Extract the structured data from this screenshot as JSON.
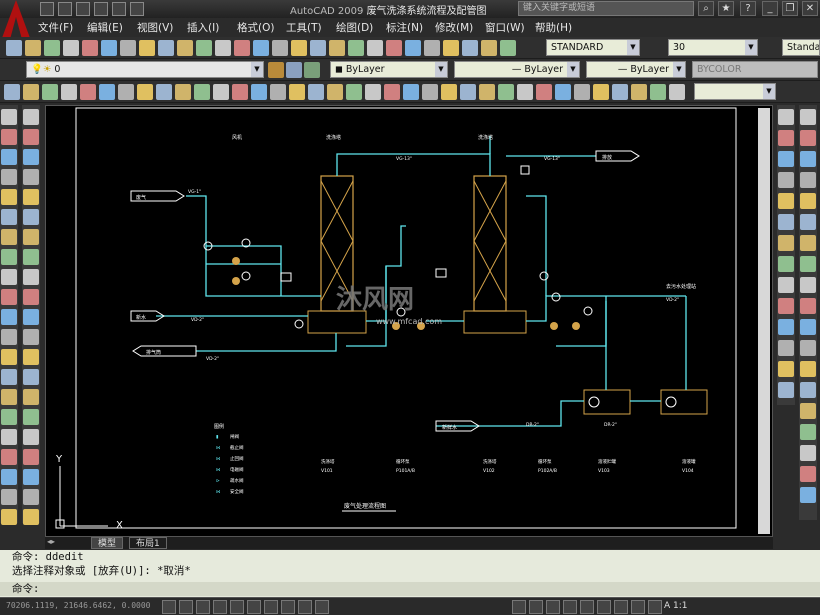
{
  "title": {
    "app": "AutoCAD 2009",
    "document": "废气洗涤系统流程及配管图"
  },
  "search": {
    "placeholder": "键入关键字或短语"
  },
  "menu": [
    "文件(F)",
    "编辑(E)",
    "视图(V)",
    "插入(I)",
    "格式(O)",
    "工具(T)",
    "绘图(D)",
    "标注(N)",
    "修改(M)",
    "窗口(W)",
    "帮助(H)"
  ],
  "toolbar1": {
    "text_style": "STANDARD",
    "text_height": "30",
    "dim_style": "Standar"
  },
  "toolbar2": {
    "layer": "0",
    "color": "ByLayer",
    "linetype": "ByLayer",
    "lineweight": "ByLayer",
    "plotstyle": "BYCOLOR"
  },
  "drawing": {
    "title": "废气处理流程图",
    "watermark": "沐风网",
    "watermark_url": "www.mfcad.com",
    "tower1_tag": "洗涤塔",
    "tower2_tag": "洗涤塔",
    "fan_tag": "风机",
    "inlet1": "废气",
    "inlet2": "新水",
    "inlet3": "新鲜水",
    "outlet1": "排气筒",
    "outlet2": "排放",
    "outlet_right": "去污水处理站",
    "pipe_vg1": "VG-1\"",
    "pipe_vg2": "VG-13\"",
    "pipe_vg3": "VG-13\"",
    "pipe_v2": "VD-2\"",
    "pipe_v3": "VD-2\"",
    "pipe_v4": "VD-2\"",
    "pipe_dr": "DR-2\"",
    "pipe_dr2": "DR-2\"",
    "legend_title": "图例",
    "legend": [
      {
        "sym": "▮",
        "label": "闸阀"
      },
      {
        "sym": "⋈",
        "label": "截止阀"
      },
      {
        "sym": "⋈",
        "label": "止回阀"
      },
      {
        "sym": "⋈",
        "label": "电磁阀"
      },
      {
        "sym": "⊳",
        "label": "疏水阀"
      },
      {
        "sym": "⋈",
        "label": "安全阀"
      }
    ],
    "equipment_labels": [
      {
        "name": "洗涤塔",
        "code": "V101"
      },
      {
        "name": "循环泵",
        "code": "P101A/B"
      },
      {
        "name": "洗涤塔",
        "code": "V102"
      },
      {
        "name": "循环泵",
        "code": "P102A/B"
      },
      {
        "name": "溶液贮罐",
        "code": "V103"
      },
      {
        "name": "溶液罐",
        "code": "V104"
      }
    ],
    "axis_y": "Y",
    "axis_x": "X"
  },
  "tabs": [
    "模型",
    "布局1"
  ],
  "command": {
    "line1": "命令:  ddedit",
    "line2": "选择注释对象或 [放弃(U)]: *取消*",
    "line3": "命令:"
  },
  "status": {
    "coords": "70206.1119, 21646.6462, 0.0000",
    "scale": "1:1"
  }
}
